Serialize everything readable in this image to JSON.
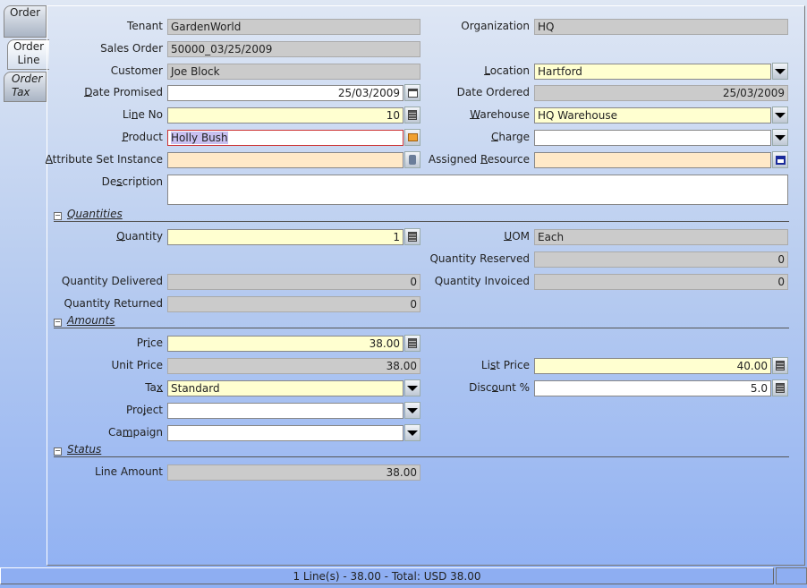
{
  "tabs": [
    {
      "label_1": "Order",
      "label_2": ""
    },
    {
      "label_1": "Order",
      "label_2": "Line",
      "active": true
    },
    {
      "label_1": "Order",
      "label_2": "Tax"
    }
  ],
  "sections": {
    "quantities": "Quantities",
    "amounts": "Amounts",
    "status": "Status"
  },
  "fields": [
    {
      "id": "tenant",
      "label": "Tenant",
      "value": "GardenWorld",
      "kind": "readonly"
    },
    {
      "id": "organization",
      "label": "Organization",
      "value": "HQ",
      "kind": "readonly"
    },
    {
      "id": "sales_order",
      "label": "Sales Order",
      "value": "50000_03/25/2009",
      "kind": "readonly"
    },
    {
      "id": "customer",
      "label": "Customer",
      "value": "Joe Block",
      "kind": "readonly"
    },
    {
      "id": "location",
      "label": "Location",
      "mnemonic": "L",
      "value": "Hartford",
      "kind": "mandatory",
      "button": "combo-arrow"
    },
    {
      "id": "date_promised",
      "label": "Date Promised",
      "mnemonic": "D",
      "value": "25/03/2009",
      "kind": "normal",
      "align": "right",
      "button": "calendar"
    },
    {
      "id": "date_ordered",
      "label": "Date Ordered",
      "value": "25/03/2009",
      "kind": "readonly",
      "align": "right"
    },
    {
      "id": "line_no",
      "label": "Line No",
      "mnemonic": "n",
      "value": "10",
      "kind": "mandatory",
      "align": "right",
      "button": "calculator"
    },
    {
      "id": "warehouse",
      "label": "Warehouse",
      "mnemonic": "W",
      "value": "HQ Warehouse",
      "kind": "mandatory",
      "button": "combo-arrow"
    },
    {
      "id": "product",
      "label": "Product",
      "mnemonic": "P",
      "value": "Holly Bush",
      "kind": "error",
      "button": "product-lookup"
    },
    {
      "id": "charge",
      "label": "Charge",
      "mnemonic": "C",
      "value": "",
      "kind": "normal",
      "button": "combo-arrow"
    },
    {
      "id": "attribute_set_instance",
      "label": "Attribute Set Instance",
      "mnemonic": "A",
      "value": "",
      "kind": "lookup",
      "button": "attribute"
    },
    {
      "id": "assigned_resource",
      "label": "Assigned Resource",
      "mnemonic": "R",
      "value": "",
      "kind": "lookup",
      "button": "resource"
    },
    {
      "id": "description",
      "label": "Description",
      "mnemonic": "s",
      "value": "",
      "kind": "normal"
    },
    {
      "id": "quantity",
      "label": "Quantity",
      "mnemonic": "Q",
      "value": "1",
      "kind": "mandatory",
      "align": "right",
      "button": "calculator"
    },
    {
      "id": "uom",
      "label": "UOM",
      "mnemonic": "U",
      "value": "Each",
      "kind": "readonly"
    },
    {
      "id": "quantity_reserved",
      "label": "Quantity Reserved",
      "value": "0",
      "kind": "readonly",
      "align": "right"
    },
    {
      "id": "quantity_delivered",
      "label": "Quantity Delivered",
      "value": "0",
      "kind": "readonly",
      "align": "right"
    },
    {
      "id": "quantity_invoiced",
      "label": "Quantity Invoiced",
      "value": "0",
      "kind": "readonly",
      "align": "right"
    },
    {
      "id": "quantity_returned",
      "label": "Quantity Returned",
      "value": "0",
      "kind": "readonly",
      "align": "right"
    },
    {
      "id": "price",
      "label": "Price",
      "mnemonic": "i",
      "value": "38.00",
      "kind": "mandatory",
      "align": "right",
      "button": "calculator"
    },
    {
      "id": "unit_price",
      "label": "Unit Price",
      "value": "38.00",
      "kind": "readonly",
      "align": "right"
    },
    {
      "id": "list_price",
      "label": "List Price",
      "mnemonic": "s",
      "value": "40.00",
      "kind": "mandatory",
      "align": "right",
      "button": "calculator"
    },
    {
      "id": "tax",
      "label": "Tax",
      "mnemonic": "x",
      "value": "Standard",
      "kind": "mandatory",
      "button": "combo-arrow"
    },
    {
      "id": "discount",
      "label": "Discount %",
      "mnemonic": "o",
      "value": "5.0",
      "kind": "normal",
      "align": "right",
      "button": "calculator"
    },
    {
      "id": "project",
      "label": "Project",
      "mnemonic": "j",
      "value": "",
      "kind": "normal",
      "button": "combo-arrow"
    },
    {
      "id": "campaign",
      "label": "Campaign",
      "mnemonic": "m",
      "value": "",
      "kind": "normal",
      "button": "combo-arrow"
    },
    {
      "id": "line_amount",
      "label": "Line Amount",
      "value": "38.00",
      "kind": "readonly",
      "align": "right"
    }
  ],
  "status_bar": {
    "text": "1 Line(s) - 38.00 -  Total: USD 38.00"
  }
}
